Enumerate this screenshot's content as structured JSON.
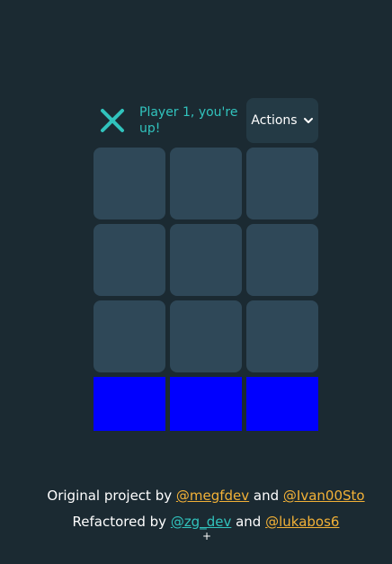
{
  "header": {
    "turn_icon": "x-icon",
    "turn_text": "Player 1, you're up!",
    "actions_label": "Actions",
    "actions_icon": "chevron-down-icon"
  },
  "board": {
    "cells": [
      "",
      "",
      "",
      "",
      "",
      "",
      "",
      "",
      ""
    ]
  },
  "score_boxes": [
    {
      "label": ""
    },
    {
      "label": ""
    },
    {
      "label": ""
    }
  ],
  "footer": {
    "line1_prefix": "Original project by ",
    "line1_link1": "@megfdev",
    "line1_and": " and ",
    "line1_link2": "@Ivan00Sto",
    "line2_prefix": "Refactored by ",
    "line2_link1": "@zg_dev",
    "line2_and": " and ",
    "line2_link2": "@lukabos6"
  },
  "colors": {
    "background": "#1b2a32",
    "x_accent": "#31c3bd",
    "cell": "#2f4858",
    "score_box": "#0000ff",
    "link_orange": "#f2b137"
  }
}
